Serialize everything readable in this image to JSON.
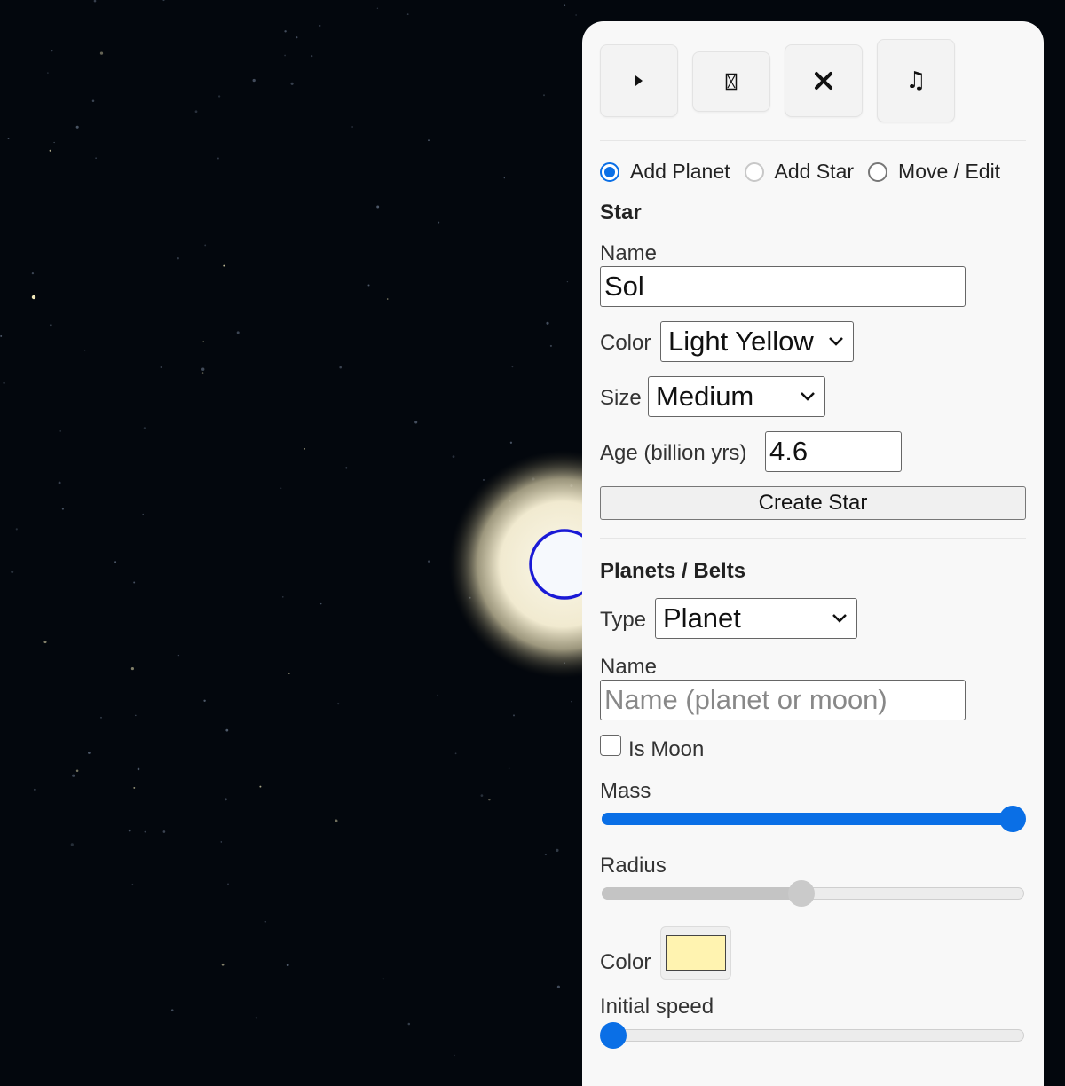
{
  "toolbar": {
    "buttons": [
      {
        "name": "play-icon",
        "glyph": "▶"
      },
      {
        "name": "hourglass-icon",
        "glyph": "⌛"
      },
      {
        "name": "close-icon",
        "glyph": "✖"
      },
      {
        "name": "music-icon",
        "glyph": "♫"
      }
    ]
  },
  "mode": {
    "options": [
      "Add Planet",
      "Add Star",
      "Move / Edit"
    ],
    "selected": "Add Planet"
  },
  "star": {
    "heading": "Star",
    "name_label": "Name",
    "name_value": "Sol",
    "color_label": "Color",
    "color_value": "Light Yellow",
    "size_label": "Size",
    "size_value": "Medium",
    "age_label": "Age (billion yrs)",
    "age_value": "4.6",
    "create_button": "Create Star"
  },
  "planets": {
    "heading": "Planets / Belts",
    "type_label": "Type",
    "type_value": "Planet",
    "name_label": "Name",
    "name_placeholder": "Name (planet or moon)",
    "is_moon_label": "Is Moon",
    "is_moon_checked": false,
    "mass_label": "Mass",
    "mass_fraction": 1.0,
    "radius_label": "Radius",
    "radius_fraction": 0.47,
    "color_label": "Color",
    "color_value": "#fff3b0",
    "speed_label": "Initial speed",
    "speed_fraction": 0.0
  },
  "colors": {
    "accent": "#0a6fe6",
    "star_glow": "#f3ecd2",
    "star_outline": "#1a1ad6",
    "space": "#03070d"
  }
}
